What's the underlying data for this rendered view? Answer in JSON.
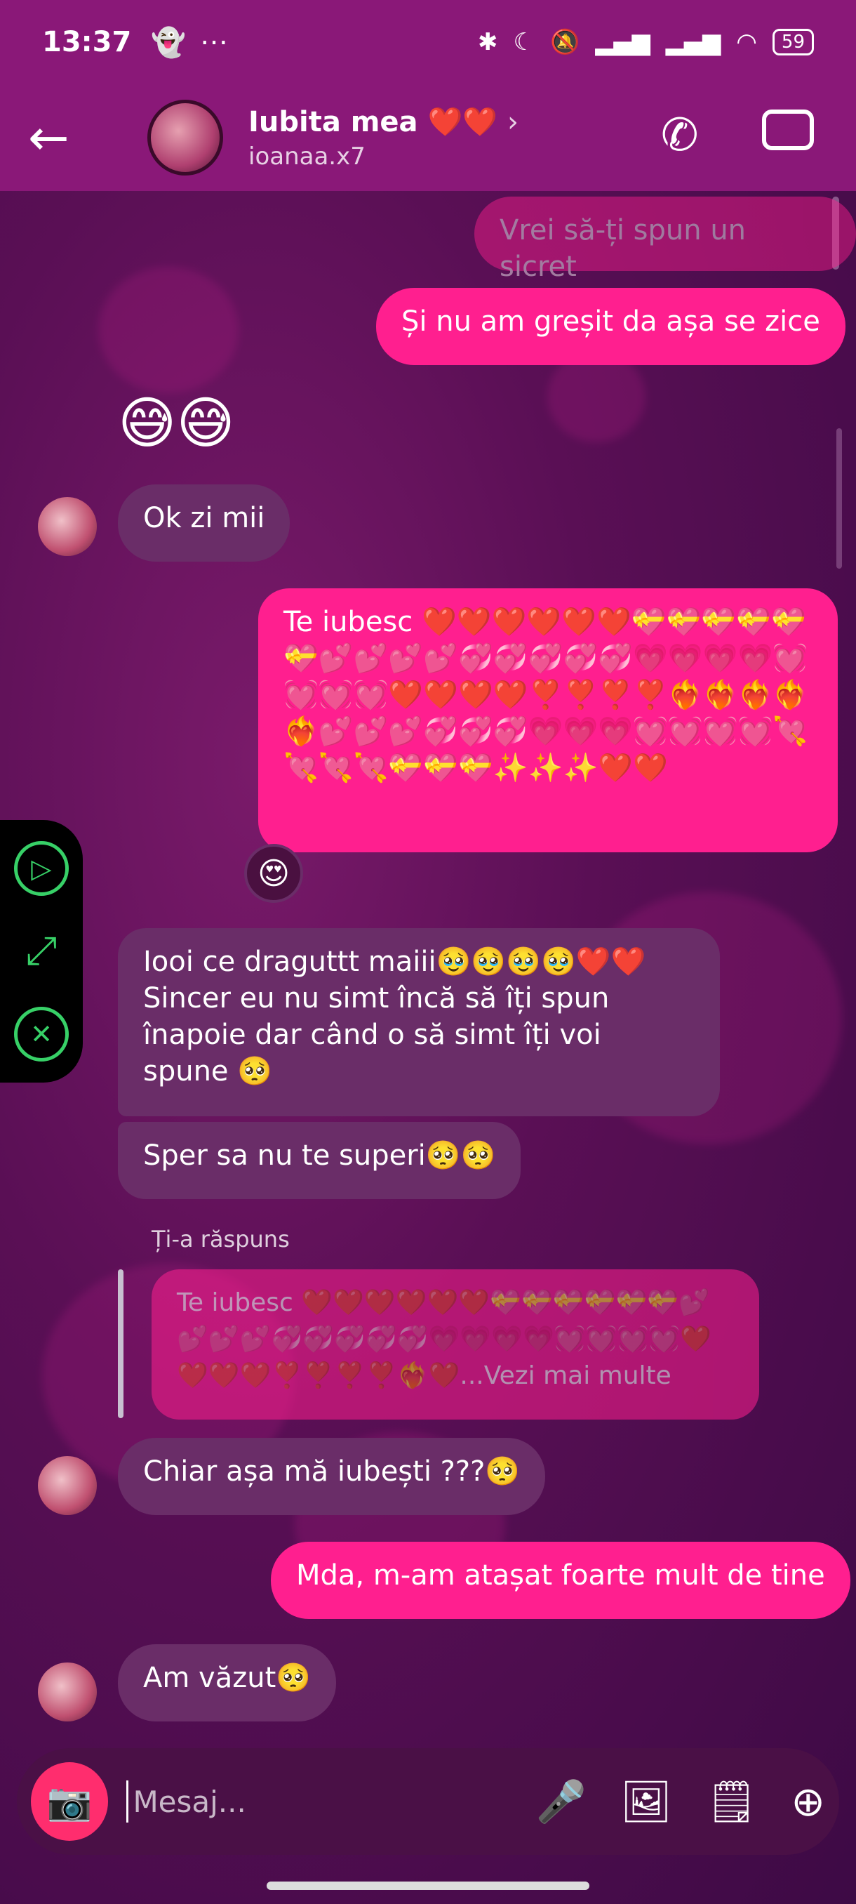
{
  "status": {
    "time": "13:37",
    "battery": "59",
    "left_icons": [
      "snapchat-icon",
      "more-dots-icon"
    ],
    "right_icons": [
      "bluetooth-icon",
      "moon-icon",
      "bell-off-icon",
      "signal-icon",
      "signal-icon",
      "wifi-icon"
    ]
  },
  "header": {
    "contact_name": "Iubita mea ❤️❤️",
    "handle": "ioanaa.x7",
    "chevron": "›",
    "back_glyph": "←",
    "call_glyph": "✆",
    "video_glyph": "▭"
  },
  "messages": {
    "m0": "Vrei să-ți spun un sicret",
    "m1": "Și nu am greșit da așa se zice",
    "m2_emoji": "😅😅",
    "m3": "Ok zi mii",
    "m4": "Te iubesc ❤️❤️❤️❤️❤️❤️💝💝💝💝💝💝💕💕💕💕💞💞💞💞💞💗💗💗💗💓💓💓💓❤️❤️❤️❤️❣️❣️❣️❣️❤️‍🔥❤️‍🔥❤️‍🔥❤️‍🔥❤️‍🔥💕💕💕💞💞💞💗💗💗💓💓💓💓💘💘💘💘💝💝💝✨✨✨❤️❤️",
    "m4_reaction": "😍",
    "m5": "Iooi ce draguttt maiii🥹🥹🥹🥹❤️❤️ Sincer eu nu simt încă să îți spun înapoie dar când o să simt îți voi spune 🥺",
    "m6": "Sper sa nu te superi🥺🥺",
    "reply_label": "Ți-a răspuns",
    "m7_quoted": "Te iubesc ❤️❤️❤️❤️❤️❤️💝💝💝💝💝💝💕💕💕💕💞💞💞💞💞💗💗💗💗💓💓💓💓❤️❤️❤️❤️❣️❣️❣️❣️❤️‍🔥❤️...Vezi mai multe",
    "m8": "Chiar așa mă iubești ???🥺",
    "m9": "Mda, m-am atașat foarte mult de tine",
    "m10": "Am văzut🥺"
  },
  "side_panel": {
    "play": "▷",
    "expand": "⤢",
    "close": "✕"
  },
  "composer": {
    "placeholder": "Mesaj...",
    "camera": "📷",
    "mic": "🎤",
    "gallery": "🖼",
    "sticker": "🗒",
    "add": "⊕"
  },
  "colors": {
    "sent": "#ff1f8f",
    "received": "#6a2d68",
    "header": "#8a1878",
    "accent": "#37d067"
  }
}
